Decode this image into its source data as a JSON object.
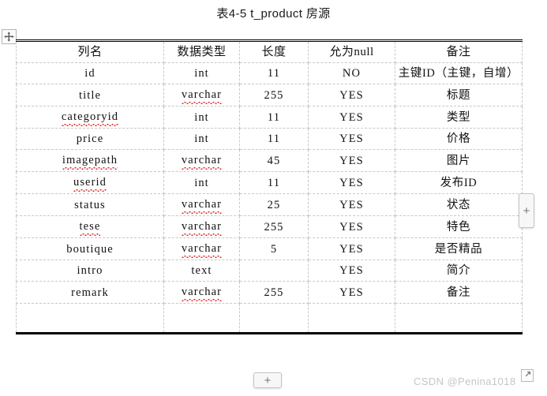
{
  "document": {
    "title": "表4-5 t_product 房源",
    "watermark": "CSDN @Penina1018"
  },
  "controls": {
    "move_handle_icon": "move-arrows-icon",
    "add_column_label": "+",
    "add_row_label": "+",
    "resize_handle_icon": "resize-arrow-icon"
  },
  "table": {
    "columns": [
      "列名",
      "数据类型",
      "长度",
      "允为null",
      "备注"
    ],
    "rows": [
      {
        "name": "id",
        "type": "int",
        "length": "11",
        "nullable": "NO",
        "remark": "主键ID（主键，自增）",
        "name_misspelled": false,
        "type_misspelled": false
      },
      {
        "name": "title",
        "type": "varchar",
        "length": "255",
        "nullable": "YES",
        "remark": "标题",
        "name_misspelled": false,
        "type_misspelled": true
      },
      {
        "name": "categoryid",
        "type": "int",
        "length": "11",
        "nullable": "YES",
        "remark": "类型",
        "name_misspelled": true,
        "type_misspelled": false
      },
      {
        "name": "price",
        "type": "int",
        "length": "11",
        "nullable": "YES",
        "remark": "价格",
        "name_misspelled": false,
        "type_misspelled": false
      },
      {
        "name": "imagepath",
        "type": "varchar",
        "length": "45",
        "nullable": "YES",
        "remark": "图片",
        "name_misspelled": true,
        "type_misspelled": true
      },
      {
        "name": "userid",
        "type": "int",
        "length": "11",
        "nullable": "YES",
        "remark": "发布ID",
        "name_misspelled": true,
        "type_misspelled": false
      },
      {
        "name": "status",
        "type": "varchar",
        "length": "25",
        "nullable": "YES",
        "remark": "状态",
        "name_misspelled": false,
        "type_misspelled": true
      },
      {
        "name": "tese",
        "type": "varchar",
        "length": "255",
        "nullable": "YES",
        "remark": "特色",
        "name_misspelled": true,
        "type_misspelled": true
      },
      {
        "name": "boutique",
        "type": "varchar",
        "length": "5",
        "nullable": "YES",
        "remark": "是否精品",
        "name_misspelled": false,
        "type_misspelled": true
      },
      {
        "name": "intro",
        "type": "text",
        "length": "",
        "nullable": "YES",
        "remark": "简介",
        "name_misspelled": false,
        "type_misspelled": false
      },
      {
        "name": "remark",
        "type": "varchar",
        "length": "255",
        "nullable": "YES",
        "remark": "备注",
        "name_misspelled": false,
        "type_misspelled": true
      }
    ],
    "trailing_empty_row": true
  }
}
